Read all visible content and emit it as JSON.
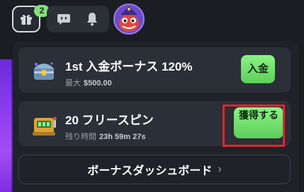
{
  "topbar": {
    "gift_badge_count": "2",
    "icons": [
      "gift-icon",
      "chat-icon",
      "bell-icon",
      "avatar-dragon"
    ]
  },
  "bonus_card": {
    "title": "1st 入金ボーナス 120%",
    "max_label": "最大",
    "max_value": "$500.00",
    "button_label": "入金"
  },
  "spins_card": {
    "title": "20 フリースピン",
    "time_label": "残り時間",
    "time_value": "23h 59m 27s",
    "button_label": "獲得する"
  },
  "dashboard": {
    "label": "ボーナスダッシュボード"
  },
  "colors": {
    "accent_green": "#6fe06c",
    "highlight_red": "#e0262b",
    "panel_bg": "#1f2228",
    "card_bg": "#2b2f37"
  }
}
